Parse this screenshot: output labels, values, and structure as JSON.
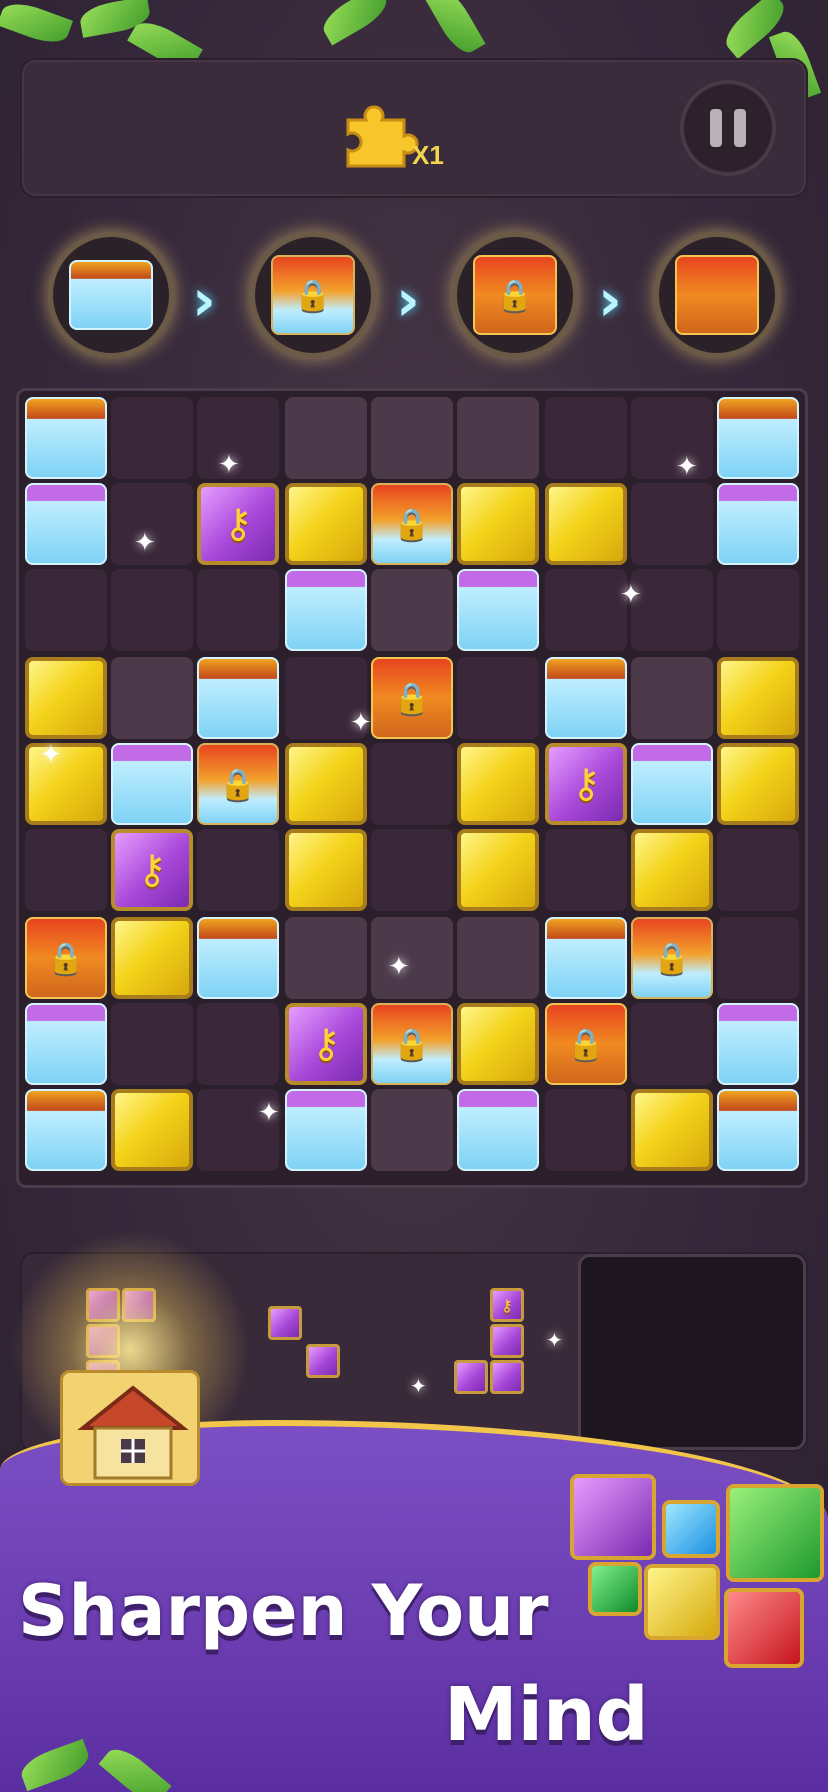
{
  "header": {
    "puzzle_pieces_label": "X1",
    "pause_label": "pause"
  },
  "goal_track": {
    "steps": [
      "frozen-chest",
      "chained-frozen-chest",
      "chained-chest",
      "open-chest"
    ]
  },
  "board": {
    "rows": 9,
    "cols": 9,
    "cells": [
      [
        "ice-chest",
        "dark",
        "dark",
        "light",
        "light",
        "light",
        "dark",
        "dark",
        "ice-chest"
      ],
      [
        "ice-purple",
        "dark",
        "key",
        "yellow",
        "chained",
        "yellow",
        "yellow",
        "dark",
        "ice-purple"
      ],
      [
        "dark",
        "dark",
        "dark",
        "ice-purple",
        "light",
        "ice-purple",
        "dark",
        "dark",
        "dark"
      ],
      [
        "yellow",
        "light",
        "ice-chest",
        "dark",
        "chest-chained",
        "dark",
        "ice-chest",
        "light",
        "yellow"
      ],
      [
        "yellow",
        "ice-purple",
        "chained",
        "yellow",
        "dark",
        "yellow",
        "key",
        "ice-purple",
        "yellow"
      ],
      [
        "dark",
        "key",
        "dark",
        "yellow",
        "dark",
        "yellow",
        "dark",
        "yellow",
        "dark"
      ],
      [
        "chest-chained",
        "yellow",
        "ice-chest",
        "light",
        "light",
        "light",
        "ice-chest",
        "chained",
        "dark"
      ],
      [
        "ice-purple",
        "dark",
        "dark",
        "key",
        "chained",
        "yellow",
        "chest-chained",
        "dark",
        "ice-purple"
      ],
      [
        "ice-chest",
        "yellow",
        "dark",
        "ice-purple",
        "light",
        "ice-purple",
        "dark",
        "yellow",
        "ice-chest"
      ]
    ]
  },
  "tray": {
    "pieces": [
      "L-piece-purple",
      "diagonal-piece-purple",
      "J-piece-purple-with-key"
    ]
  },
  "banner": {
    "line1": "Sharpen Your",
    "line2": "Mind"
  },
  "colors": {
    "yellow": "#f4d31a",
    "purple": "#a747d8",
    "ice": "#7fd2f5",
    "banner": "#6a3cb0",
    "banner_border": "#f1c64b"
  }
}
